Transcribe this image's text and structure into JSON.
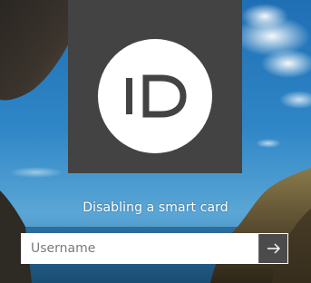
{
  "login": {
    "status_message": "Disabling a smart card",
    "username_placeholder": "Username",
    "username_value": "",
    "avatar_icon": "smart-card-id-icon",
    "submit_icon": "arrow-right-icon"
  },
  "colors": {
    "tile_background": "#434343",
    "avatar_circle": "#ffffff",
    "submit_button": "#4b4b4b",
    "text": "#ffffff"
  }
}
